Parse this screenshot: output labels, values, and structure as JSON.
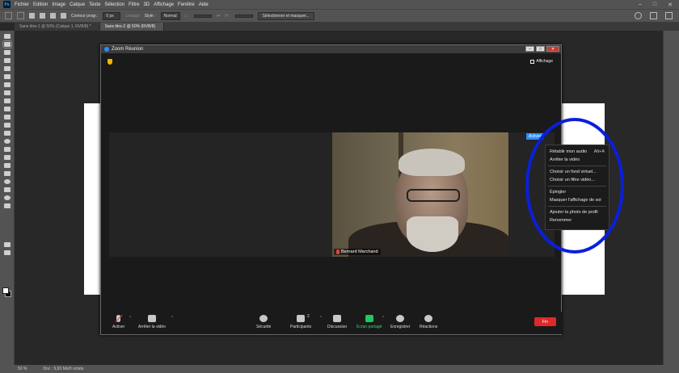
{
  "photoshop": {
    "logo": "Ps",
    "menu": [
      "Fichier",
      "Edition",
      "Image",
      "Calque",
      "Texte",
      "Sélection",
      "Filtre",
      "3D",
      "Affichage",
      "Fenêtre",
      "Aide"
    ],
    "options": {
      "contour_label": "Contour progr.:",
      "contour_value": "0 px",
      "lissage_label": "Lissage",
      "style_label": "Style :",
      "style_value": "Normal",
      "width_label": "L :",
      "height_label": "H :",
      "select_mask_button": "Sélectionner et masquer..."
    },
    "tabs": [
      "Sans titre-1 @ 50% (Calque 1, RVB/8) *",
      "Sans titre-2 @ 50% (RVB/8)"
    ],
    "status": {
      "zoom": "50 %",
      "doc": "Doc : 5,93 Mo/0 octets"
    }
  },
  "zoom": {
    "title": "Zoom Réunion",
    "view_label": "Affichage",
    "active_badge": "Activer",
    "participant_name": "Bernard Marchand",
    "context_menu": [
      {
        "label": "Rétablir mon audio",
        "shortcut": "Alt+A"
      },
      {
        "label": "Arrêter la vidéo"
      },
      {
        "label": "Choisir un fond virtuel..."
      },
      {
        "label": "Choisir un filtre vidéo..."
      },
      {
        "label": "Épingler"
      },
      {
        "label": "Masquer l'affichage de soi"
      },
      {
        "label": "Ajouter la photo de profil"
      },
      {
        "label": "Renommer"
      }
    ],
    "toolbar": {
      "unmute": "Activer",
      "stop_video": "Arrêter la vidéo",
      "security": "Sécurité",
      "participants": "Participants",
      "participants_count": "2",
      "chat": "Discussion",
      "share": "Écran partagé",
      "record": "Enregistrer",
      "reactions": "Réactions",
      "end": "Fin"
    }
  }
}
